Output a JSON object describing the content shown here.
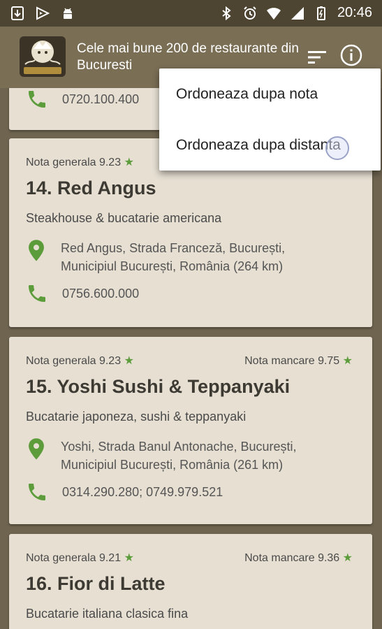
{
  "status_bar": {
    "time": "20:46",
    "left_icons": [
      "download-icon",
      "play-store-icon",
      "android-icon"
    ],
    "right_icons": [
      "bluetooth-icon",
      "alarm-icon",
      "wifi-icon",
      "signal-icon",
      "battery-icon"
    ]
  },
  "app_bar": {
    "title": "Cele mai bune 200 de restaurante din Bucuresti",
    "logo_icon": "restaurant-logo-icon",
    "actions": [
      "sort-icon",
      "info-icon"
    ]
  },
  "menu": {
    "items": [
      "Ordoneaza dupa nota",
      "Ordoneaza dupa distanta"
    ]
  },
  "restaurants": [
    {
      "phone": "0720.100.400"
    },
    {
      "overall_label": "Nota generala 9.23",
      "title": "14. Red Angus",
      "cuisine": "Steakhouse & bucatarie americana",
      "address_line1": "Red Angus, Strada Franceză, București,",
      "address_line2": "Municipiul București, România (264 km)",
      "phone": "0756.600.000"
    },
    {
      "overall_label": "Nota generala 9.23",
      "food_label": "Nota mancare 9.75",
      "title": "15. Yoshi Sushi & Teppanyaki",
      "cuisine": "Bucatarie japoneza, sushi & teppanyaki",
      "address_line1": "Yoshi, Strada Banul Antonache, București,",
      "address_line2": "Municipiul București, România (261 km)",
      "phone": "0314.290.280; 0749.979.521"
    },
    {
      "overall_label": "Nota generala 9.21",
      "food_label": "Nota mancare 9.36",
      "title": "16. Fior di Latte",
      "cuisine": "Bucatarie italiana clasica fina"
    }
  ],
  "colors": {
    "accent_green": "#5c9c3b",
    "app_bar": "#7a6e55",
    "card": "#e6dfd2"
  }
}
